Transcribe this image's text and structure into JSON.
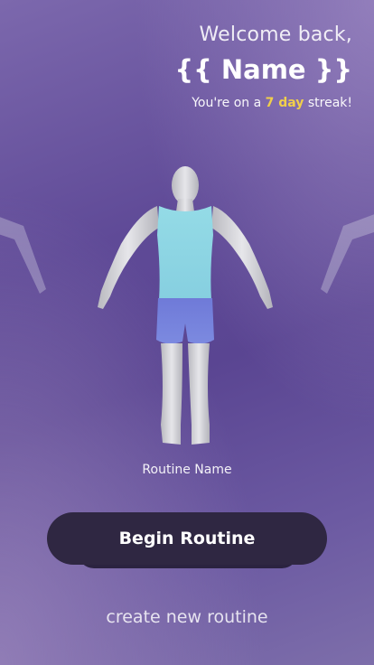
{
  "header": {
    "welcome_text": "Welcome back,",
    "username": "{{ Name }}",
    "streak_prefix": "You're on a ",
    "streak_days": "7 day",
    "streak_suffix": " streak!"
  },
  "carousel": {
    "routine_name": "Routine Name",
    "figure_icon": "human-body-model-icon"
  },
  "actions": {
    "begin_label": "Begin Routine",
    "create_label": "create new routine"
  },
  "colors": {
    "streak_highlight": "#f1cf4a",
    "button_bg": "#2f2742",
    "shirt": "#8fd3e0",
    "shorts": "#6f78d6"
  }
}
